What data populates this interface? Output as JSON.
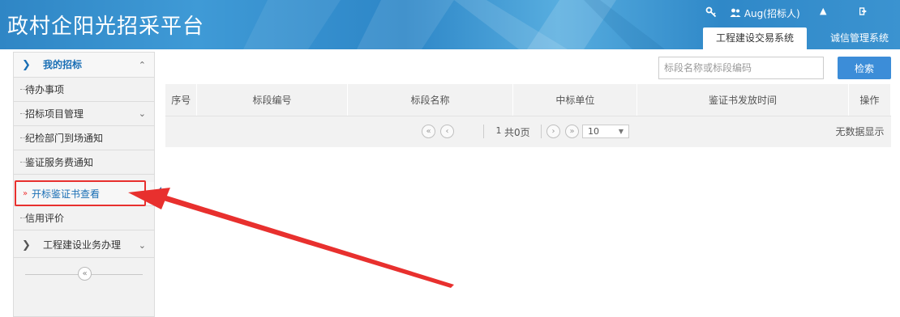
{
  "header": {
    "title": "政村企阳光招采平台",
    "user_name": "Aug(招标人)",
    "tabs": [
      {
        "label": "工程建设交易系统",
        "active": true
      },
      {
        "label": "诚信管理系统",
        "active": false
      }
    ]
  },
  "sidebar": {
    "group1": {
      "label": "我的招标",
      "expanded": true
    },
    "items": [
      {
        "label": "待办事项"
      },
      {
        "label": "招标项目管理",
        "has_submenu": true
      },
      {
        "label": "纪检部门到场通知"
      },
      {
        "label": "鉴证服务费通知"
      },
      {
        "label": "开标鉴证书查看",
        "active": true
      },
      {
        "label": "信用评价"
      }
    ],
    "group2": {
      "label": "工程建设业务办理",
      "expanded": false
    }
  },
  "search": {
    "placeholder": "标段名称或标段编码",
    "button_label": "检索"
  },
  "table": {
    "columns": [
      "序号",
      "标段编号",
      "标段名称",
      "中标单位",
      "鉴证书发放时间",
      "操作"
    ]
  },
  "pagination": {
    "current_page": "1",
    "total_text": "共0页",
    "page_size": "10",
    "empty_text": "无数据显示"
  },
  "colors": {
    "header_blue": "#2f86c5",
    "accent_blue": "#1a6fb5",
    "search_button": "#3c8dd8",
    "annotation_red": "#e8302e"
  },
  "icons": [
    "search-key-icon",
    "user-icon",
    "logout-icon",
    "chevron-right-icon",
    "chevron-up-icon",
    "chevron-down-icon",
    "double-left-icon",
    "left-icon",
    "right-icon",
    "double-right-icon"
  ]
}
